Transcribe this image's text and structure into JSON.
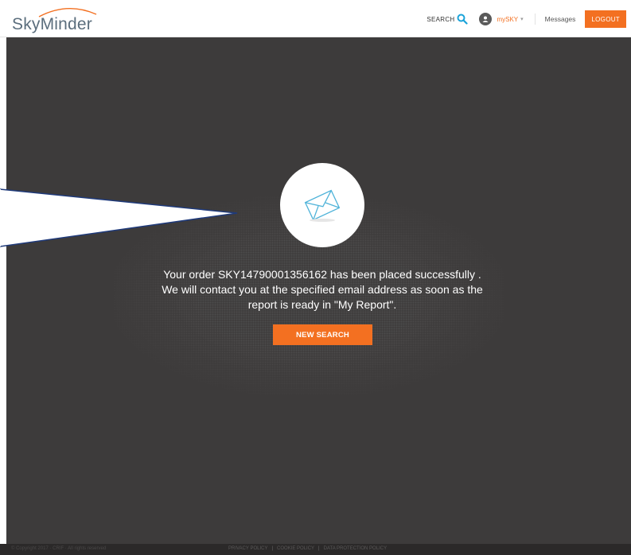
{
  "header": {
    "logo_text": "SkyMinder",
    "search_label": "SEARCH",
    "mysky_label": "mySKY",
    "mysky_caret": "▾",
    "messages_label": "Messages",
    "logout_label": "LOGOUT"
  },
  "main": {
    "message_line1": "Your order SKY14790001356162 has been placed successfully .",
    "message_line2": "We will contact you at the specified email address as soon as the",
    "message_line3": "report is ready in \"My Report\".",
    "new_search_label": "NEW SEARCH"
  },
  "footer": {
    "copyright": "© Copyright 2017 · CRIF · All rights reserved",
    "links": [
      "PRIVACY POLICY",
      "COOKIE POLICY",
      "DATA PROTECTION POLICY"
    ]
  },
  "colors": {
    "accent": "#f37021",
    "background_dark": "#3d3b3b",
    "callout_stroke": "#1f3a7a"
  },
  "icons": [
    "search-icon",
    "user-icon",
    "envelope-icon"
  ]
}
